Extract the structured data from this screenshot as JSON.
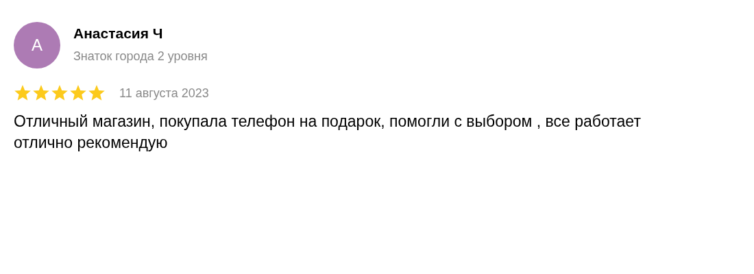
{
  "review": {
    "author": {
      "initial": "А",
      "name": "Анастасия Ч",
      "status": "Знаток города 2 уровня"
    },
    "stars": 5,
    "date": "11 августа 2023",
    "text": "Отличный магазин, покупала телефон на подарок, помогли с выбором , все работает отлично рекомендую"
  }
}
